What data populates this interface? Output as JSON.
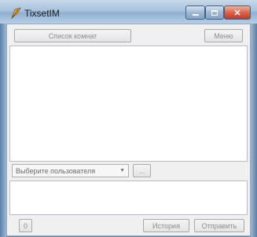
{
  "window": {
    "title": "TixsetIM"
  },
  "toolbar": {
    "room_list_label": "Список комнат",
    "menu_label": "Меню"
  },
  "user_select": {
    "selected": "Выберите пользователя",
    "more_label": "..."
  },
  "footer": {
    "counter": "0",
    "history_label": "История",
    "send_label": "Отправить"
  },
  "colors": {
    "title_bg": "#a9c2dc",
    "close_button": "#d9654a",
    "panel_bg": "#f0f0f0"
  },
  "icons": {
    "app": "feather-pen-icon",
    "minimize": "minimize-icon",
    "maximize": "maximize-icon",
    "close": "close-icon",
    "dropdown": "chevron-down-icon"
  }
}
